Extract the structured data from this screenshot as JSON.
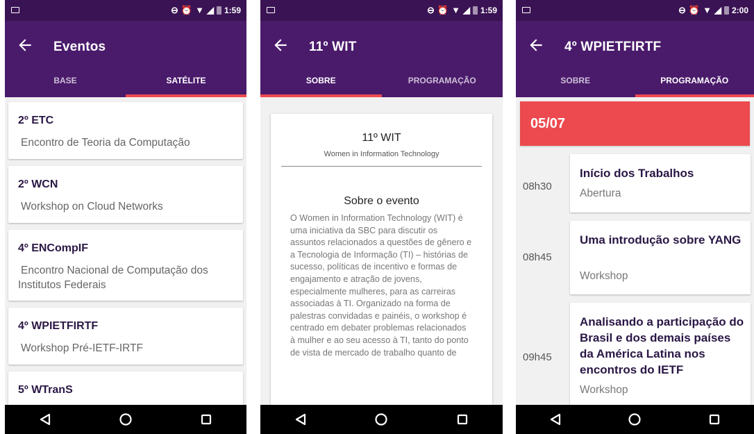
{
  "phones": [
    {
      "status_time": "1:59",
      "title": "Eventos",
      "tabs": [
        {
          "label": "BASE",
          "active": false
        },
        {
          "label": "SATÉLITE",
          "active": true
        }
      ],
      "events": [
        {
          "name": "2º ETC",
          "desc": "Encontro de Teoria da Computação"
        },
        {
          "name": "2º WCN",
          "desc": "Workshop on Cloud Networks"
        },
        {
          "name": "4º ENCompIF",
          "desc": "Encontro Nacional de Computação dos Institutos Federais"
        },
        {
          "name": "4º WPIETFIRTF",
          "desc": "Workshop Pré-IETF-IRTF"
        },
        {
          "name": "5º WTranS",
          "desc": ""
        }
      ]
    },
    {
      "status_time": "1:59",
      "title": "11º WIT",
      "tabs": [
        {
          "label": "SOBRE",
          "active": true
        },
        {
          "label": "PROGRAMAÇÃO",
          "active": false
        }
      ],
      "about": {
        "title": "11º WIT",
        "subtitle": "Women in Information Technology",
        "heading": "Sobre o evento",
        "body": "O Women in Information Technology (WIT) é uma iniciativa da SBC para discutir os assuntos relacionados a questões de gênero e a Tecnologia de Informação (TI) – histórias de sucesso, políticas de incentivo e formas de engajamento e atração de jovens, especialmente mulheres, para as carreiras associadas à TI. Organizado na forma de palestras convidadas e painéis, o workshop é centrado em debater problemas relacionados à mulher e ao seu acesso à TI, tanto do ponto de vista de mercado de trabalho quanto de"
      }
    },
    {
      "status_time": "2:00",
      "title": "4º WPIETFIRTF",
      "tabs": [
        {
          "label": "SOBRE",
          "active": false
        },
        {
          "label": "PROGRAMAÇÃO",
          "active": true
        }
      ],
      "date": "05/07",
      "schedule": [
        {
          "time": "08h30",
          "title": "Início dos Trabalhos",
          "type": "Abertura"
        },
        {
          "time": "08h45",
          "title": "Uma introdução sobre YANG",
          "type": "Workshop"
        },
        {
          "time": "09h45",
          "title": "Analisando a participação do Brasil e dos demais países da América Latina nos encontros do IETF",
          "type": "Workshop"
        }
      ]
    }
  ],
  "colors": {
    "status_bar": "#3a1354",
    "app_bar": "#4a1a6b",
    "accent": "#ef4a50",
    "date_bar": "#ec4a4f"
  },
  "icons": {
    "back": "arrow-left-icon",
    "nav_back": "triangle-back-icon",
    "nav_home": "circle-home-icon",
    "nav_recents": "square-recents-icon"
  }
}
